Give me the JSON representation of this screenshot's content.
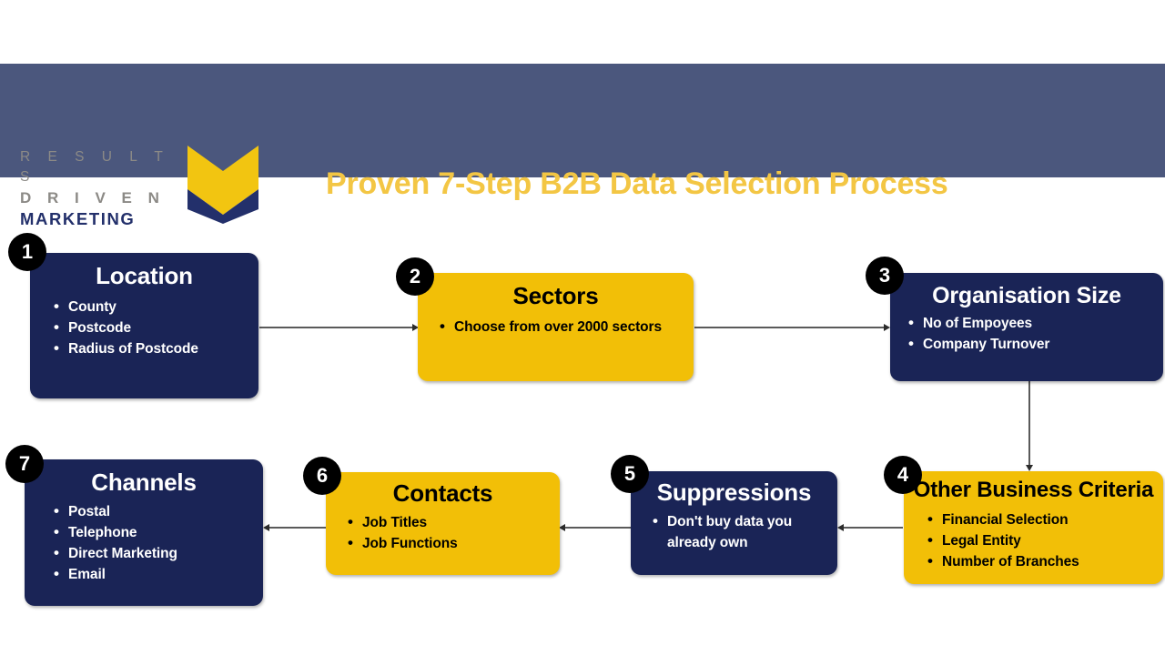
{
  "header": {
    "title": "Proven 7-Step B2B Data Selection Process",
    "band_color": "#4b577d",
    "title_color": "#f3c644",
    "logo": {
      "line1": "R E S U L T S",
      "line2": "D R I V E N",
      "line3": "MARKETING",
      "mark": "chevron-logo-mark"
    }
  },
  "palette": {
    "navy": "#1a2456",
    "gold": "#f2bf07",
    "badge": "#000000",
    "connector": "#5a5a5a"
  },
  "steps": [
    {
      "number": "1",
      "title": "Location",
      "style": "navy",
      "items": [
        "County",
        "Postcode",
        "Radius of Postcode"
      ]
    },
    {
      "number": "2",
      "title": "Sectors",
      "style": "gold",
      "items": [
        "Choose from over 2000 sectors"
      ]
    },
    {
      "number": "3",
      "title": "Organisation Size",
      "style": "navy",
      "items": [
        "No of Empoyees",
        "Company Turnover"
      ]
    },
    {
      "number": "4",
      "title": "Other Business Criteria",
      "style": "gold",
      "items": [
        "Financial Selection",
        "Legal Entity",
        "Number of Branches"
      ]
    },
    {
      "number": "5",
      "title": "Suppressions",
      "style": "navy",
      "items": [
        "Don't buy data you already own"
      ]
    },
    {
      "number": "6",
      "title": "Contacts",
      "style": "gold",
      "items": [
        "Job Titles",
        "Job Functions"
      ]
    },
    {
      "number": "7",
      "title": "Channels",
      "style": "navy",
      "items": [
        "Postal",
        "Telephone",
        "Direct Marketing",
        "Email"
      ]
    }
  ],
  "connectors": [
    {
      "name": "arrow-step1-to-step2",
      "direction": "right"
    },
    {
      "name": "arrow-step2-to-step3",
      "direction": "right"
    },
    {
      "name": "arrow-step3-to-step4",
      "direction": "down"
    },
    {
      "name": "arrow-step4-to-step5",
      "direction": "left"
    },
    {
      "name": "arrow-step5-to-step6",
      "direction": "left"
    },
    {
      "name": "arrow-step6-to-step7",
      "direction": "left"
    }
  ]
}
